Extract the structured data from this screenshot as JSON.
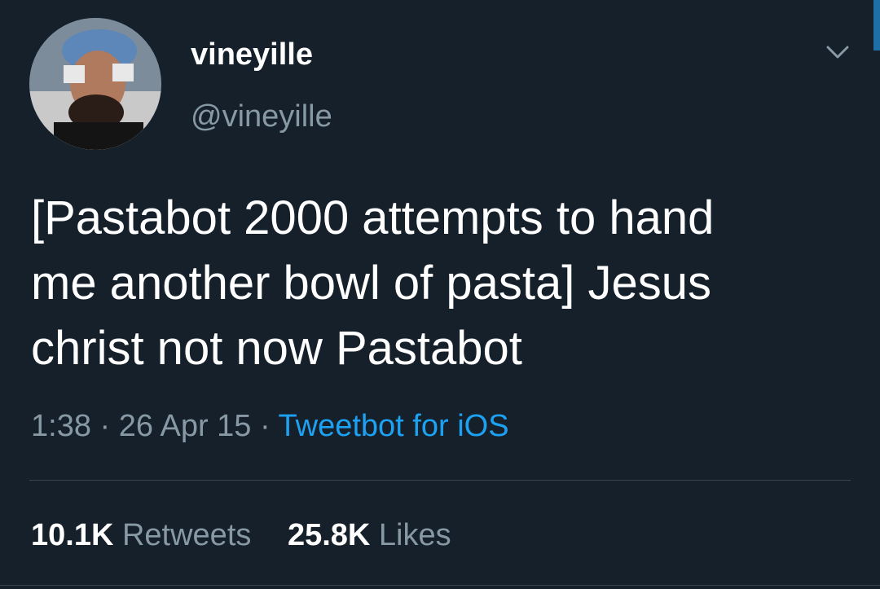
{
  "tweet": {
    "display_name": "vineyille",
    "handle": "@vineyille",
    "text": "[Pastabot 2000 attempts to hand\nme another bowl of pasta] Jesus\nchrist not now Pastabot",
    "time": "1:38",
    "separator": "·",
    "date": "26 Apr 15",
    "source": "Tweetbot for iOS",
    "retweets_count": "10.1K",
    "retweets_label": "Retweets",
    "likes_count": "25.8K",
    "likes_label": "Likes"
  },
  "colors": {
    "background": "#15202b",
    "text": "#ffffff",
    "secondary": "#8899a6",
    "link": "#1da1f2",
    "divider": "#38444d"
  },
  "icons": {
    "menu": "chevron-down-icon"
  }
}
